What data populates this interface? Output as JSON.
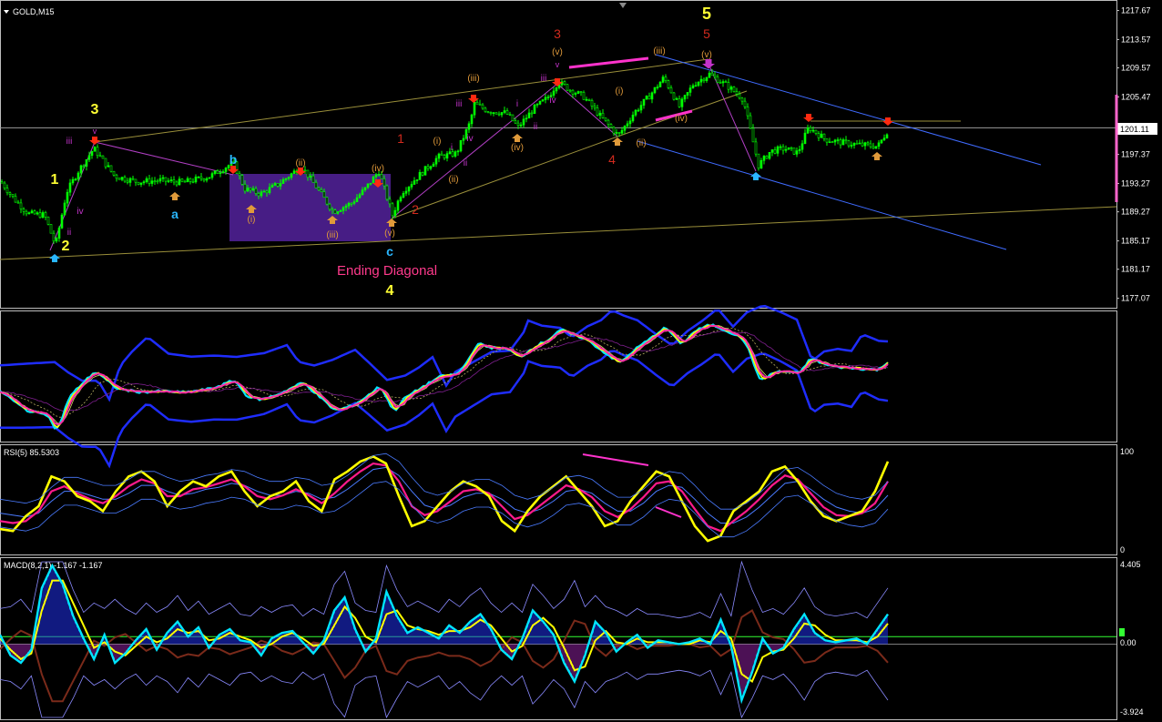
{
  "colors": {
    "background": "#000000",
    "frame": "#bdbdbd",
    "candle": "#00ff00",
    "channel": "#3f6bff",
    "trendline": "#9a8f3a",
    "diagonal_box": "#4b1f8c",
    "ending_text": "#ff3a8c",
    "wave_yellow": "#ffff33",
    "wave_red": "#d22a1e",
    "wave_cyan": "#29b6ff",
    "wave_orange": "#e09a3a",
    "wave_purple": "#c233c9",
    "down_arrow": "#ff2a10",
    "up_arrow": "#29b6ff",
    "band": "#1f2dff",
    "rsi_fast": "#ffff00",
    "rsi_slow": "#ff1a8c",
    "rsi_band": "#4a7bff",
    "macd_main": "#ffff00",
    "macd_signal": "#00e5ff",
    "macd_hist_pos": "#2233ff",
    "macd_hist_neg": "#9922aa",
    "zero_line": "#33ff33",
    "price_line": "#ff66cc"
  },
  "main": {
    "symbol_label": "GOLD,M15",
    "current_price": "1201.11",
    "ending_diagonal_label": "Ending Diagonal"
  },
  "rsi": {
    "title": "RSI(5) 85.5303",
    "top_label": "100",
    "bottom_label": "0"
  },
  "macd": {
    "title": "MACD(8,2,1) -1.167 -1.167",
    "top_label": "4.405",
    "zero_label": "0.00",
    "bottom_label": "-3.924"
  },
  "chart_data": [
    {
      "type": "candlestick",
      "title": "GOLD,M15",
      "ylim": [
        1176.0,
        1218.5
      ],
      "y_ticks": [
        "1217.67",
        "1213.57",
        "1209.57",
        "1205.47",
        "1201.11",
        "1197.37",
        "1193.27",
        "1189.27",
        "1185.17",
        "1181.17",
        "1177.07"
      ],
      "path": [
        [
          0,
          1193.5
        ],
        [
          15,
          1191.0
        ],
        [
          30,
          1189.0
        ],
        [
          48,
          1188.8
        ],
        [
          60,
          1184.5
        ],
        [
          72,
          1192.0
        ],
        [
          85,
          1195.0
        ],
        [
          102,
          1198.2
        ],
        [
          125,
          1194.3
        ],
        [
          150,
          1193.5
        ],
        [
          175,
          1193.7
        ],
        [
          200,
          1193.4
        ],
        [
          230,
          1194.3
        ],
        [
          255,
          1196.2
        ],
        [
          268,
          1192.5
        ],
        [
          285,
          1191.8
        ],
        [
          305,
          1193.2
        ],
        [
          330,
          1195.7
        ],
        [
          345,
          1193.0
        ],
        [
          365,
          1189.3
        ],
        [
          385,
          1190.5
        ],
        [
          400,
          1192.5
        ],
        [
          415,
          1195.0
        ],
        [
          430,
          1188.8
        ],
        [
          440,
          1192.0
        ],
        [
          460,
          1194.5
        ],
        [
          480,
          1197.0
        ],
        [
          500,
          1197.5
        ],
        [
          515,
          1201.8
        ],
        [
          520,
          1204.5
        ],
        [
          535,
          1203.5
        ],
        [
          555,
          1203.2
        ],
        [
          568,
          1201.2
        ],
        [
          585,
          1203.8
        ],
        [
          600,
          1205.3
        ],
        [
          612,
          1207.6
        ],
        [
          625,
          1206.5
        ],
        [
          640,
          1205.5
        ],
        [
          660,
          1202.5
        ],
        [
          678,
          1200.0
        ],
        [
          695,
          1203.2
        ],
        [
          712,
          1205.6
        ],
        [
          728,
          1208.2
        ],
        [
          745,
          1204.1
        ],
        [
          760,
          1207.2
        ],
        [
          778,
          1208.7
        ],
        [
          798,
          1207.0
        ],
        [
          815,
          1205.2
        ],
        [
          832,
          1195.8
        ],
        [
          845,
          1197.8
        ],
        [
          860,
          1198.2
        ],
        [
          875,
          1197.6
        ],
        [
          887,
          1201.2
        ],
        [
          905,
          1199.5
        ],
        [
          925,
          1199.0
        ],
        [
          945,
          1198.7
        ],
        [
          963,
          1198.5
        ],
        [
          975,
          1201.0
        ]
      ],
      "horizontal_line": 1201.11,
      "wave_labels": [
        {
          "text": "3",
          "x": 104,
          "y": 125,
          "color": "yellow",
          "size": 16
        },
        {
          "text": "1",
          "x": 60,
          "y": 202,
          "color": "yellow",
          "size": 16
        },
        {
          "text": "2",
          "x": 72,
          "y": 275,
          "color": "yellow",
          "size": 16
        },
        {
          "text": "iii",
          "x": 76,
          "y": 158,
          "color": "purple",
          "size": 10
        },
        {
          "text": "iv",
          "x": 88,
          "y": 235,
          "color": "purple",
          "size": 10
        },
        {
          "text": "ii",
          "x": 76,
          "y": 258,
          "color": "purple",
          "size": 10
        },
        {
          "text": "v",
          "x": 104,
          "y": 147,
          "color": "purple",
          "size": 9
        },
        {
          "text": "a",
          "x": 192,
          "y": 240,
          "color": "cyan",
          "size": 14
        },
        {
          "text": "b",
          "x": 256,
          "y": 180,
          "color": "cyan",
          "size": 14
        },
        {
          "text": "c",
          "x": 428,
          "y": 281,
          "color": "cyan",
          "size": 14
        },
        {
          "text": "4",
          "x": 428,
          "y": 324,
          "color": "yellow",
          "size": 16
        },
        {
          "text": "(i)",
          "x": 276,
          "y": 244,
          "color": "orange",
          "size": 10
        },
        {
          "text": "(ii)",
          "x": 330,
          "y": 182,
          "color": "orange",
          "size": 10
        },
        {
          "text": "(iii)",
          "x": 365,
          "y": 261,
          "color": "orange",
          "size": 10
        },
        {
          "text": "(iv)",
          "x": 415,
          "y": 188,
          "color": "orange",
          "size": 10
        },
        {
          "text": "(v)",
          "x": 428,
          "y": 259,
          "color": "orange",
          "size": 10
        },
        {
          "text": "1",
          "x": 440,
          "y": 157,
          "color": "red",
          "size": 14
        },
        {
          "text": "2",
          "x": 456,
          "y": 235,
          "color": "red",
          "size": 14
        },
        {
          "text": "(i)",
          "x": 480,
          "y": 158,
          "color": "orange",
          "size": 10
        },
        {
          "text": "(ii)",
          "x": 498,
          "y": 200,
          "color": "orange",
          "size": 10
        },
        {
          "text": "(iii)",
          "x": 520,
          "y": 89,
          "color": "orange",
          "size": 10
        },
        {
          "text": "(iv)",
          "x": 568,
          "y": 165,
          "color": "orange",
          "size": 10
        },
        {
          "text": "(v)",
          "x": 612,
          "y": 60,
          "color": "orange",
          "size": 10
        },
        {
          "text": "3",
          "x": 612,
          "y": 42,
          "color": "red",
          "size": 14
        },
        {
          "text": "iii",
          "x": 504,
          "y": 117,
          "color": "purple",
          "size": 10
        },
        {
          "text": "iv",
          "x": 516,
          "y": 155,
          "color": "purple",
          "size": 10
        },
        {
          "text": "ii",
          "x": 511,
          "y": 182,
          "color": "purple",
          "size": 10
        },
        {
          "text": "i",
          "x": 496,
          "y": 165,
          "color": "purple",
          "size": 10
        },
        {
          "text": "i",
          "x": 568,
          "y": 117,
          "color": "purple",
          "size": 10
        },
        {
          "text": "ii",
          "x": 588,
          "y": 142,
          "color": "purple",
          "size": 10
        },
        {
          "text": "iii",
          "x": 597,
          "y": 89,
          "color": "purple",
          "size": 10
        },
        {
          "text": "iv",
          "x": 607,
          "y": 113,
          "color": "purple",
          "size": 10
        },
        {
          "text": "v",
          "x": 612,
          "y": 74,
          "color": "purple",
          "size": 9
        },
        {
          "text": "4",
          "x": 672,
          "y": 180,
          "color": "red",
          "size": 14
        },
        {
          "text": "(i)",
          "x": 680,
          "y": 103,
          "color": "orange",
          "size": 10
        },
        {
          "text": "(ii)",
          "x": 704,
          "y": 160,
          "color": "orange",
          "size": 10
        },
        {
          "text": "(iii)",
          "x": 724,
          "y": 59,
          "color": "orange",
          "size": 10
        },
        {
          "text": "(iv)",
          "x": 748,
          "y": 133,
          "color": "orange",
          "size": 10
        },
        {
          "text": "(v)",
          "x": 776,
          "y": 63,
          "color": "orange",
          "size": 10
        },
        {
          "text": "5",
          "x": 776,
          "y": 21,
          "color": "yellow",
          "size": 18
        },
        {
          "text": "5",
          "x": 776,
          "y": 42,
          "color": "red",
          "size": 14
        }
      ]
    },
    {
      "type": "line",
      "title": "RSI(5) 85.5303",
      "ylim": [
        0,
        100
      ],
      "y_ticks": [
        "100",
        "0"
      ],
      "series": [
        {
          "values": [
            22,
            20,
            35,
            45,
            75,
            70,
            55,
            50,
            40,
            60,
            75,
            80,
            70,
            45,
            60,
            70,
            65,
            75,
            80,
            60,
            45,
            55,
            60,
            70,
            50,
            40,
            72,
            80,
            90,
            95,
            88,
            55,
            25,
            30,
            45,
            60,
            70,
            65,
            55,
            30,
            20,
            40,
            55,
            65,
            75,
            60,
            45,
            25,
            30,
            50,
            65,
            80,
            75,
            50,
            25,
            10,
            15,
            40,
            50,
            60,
            80,
            85,
            70,
            50,
            35,
            30,
            35,
            40,
            60,
            90
          ]
        },
        {
          "values": [
            30,
            28,
            30,
            40,
            60,
            65,
            58,
            52,
            48,
            55,
            65,
            72,
            68,
            55,
            55,
            62,
            64,
            68,
            72,
            65,
            55,
            52,
            56,
            62,
            56,
            48,
            58,
            70,
            80,
            88,
            86,
            70,
            45,
            36,
            40,
            50,
            60,
            62,
            58,
            45,
            32,
            36,
            46,
            56,
            66,
            62,
            54,
            40,
            34,
            42,
            54,
            68,
            70,
            60,
            42,
            25,
            20,
            30,
            40,
            52,
            66,
            76,
            72,
            58,
            44,
            36,
            35,
            38,
            48,
            70
          ]
        },
        {
          "values": [
            38,
            36,
            34,
            38,
            50,
            60,
            60,
            56,
            52,
            52,
            58,
            66,
            66,
            60,
            56,
            58,
            62,
            64,
            68,
            66,
            60,
            56,
            56,
            60,
            58,
            52,
            54,
            62,
            72,
            82,
            84,
            76,
            60,
            46,
            42,
            46,
            54,
            58,
            58,
            52,
            42,
            38,
            42,
            50,
            60,
            62,
            58,
            48,
            40,
            40,
            48,
            60,
            66,
            64,
            52,
            38,
            28,
            28,
            34,
            44,
            56,
            68,
            70,
            62,
            52,
            44,
            40,
            38,
            42,
            56
          ]
        }
      ]
    },
    {
      "type": "line",
      "title": "MACD(8,2,1) -1.167 -1.167",
      "ylim": [
        -3.924,
        4.405
      ],
      "y_ticks": [
        "4.405",
        "0.00",
        "-3.924"
      ],
      "series": [
        {
          "values": [
            0.5,
            -0.6,
            -1.0,
            -0.3,
            3.0,
            4.2,
            3.2,
            1.5,
            0.3,
            -0.8,
            0.5,
            -1.0,
            -0.5,
            0.2,
            0.8,
            -0.3,
            0.6,
            1.2,
            0.4,
            0.9,
            -0.2,
            0.5,
            0.8,
            0.2,
            0.1,
            -0.6,
            0.3,
            0.6,
            0.7,
            0.1,
            -0.5,
            0.2,
            1.8,
            2.5,
            0.8,
            -0.4,
            0.3,
            2.8,
            1.5,
            0.6,
            0.9,
            0.6,
            0.3,
            1.0,
            0.6,
            1.2,
            1.6,
            0.8,
            -0.3,
            -0.8,
            0.3,
            1.8,
            1.2,
            0.5,
            -1.0,
            -2.0,
            -0.6,
            1.2,
            0.6,
            -0.4,
            0.1,
            0.5,
            -0.2,
            0.2,
            0.1,
            0.0,
            0.1,
            0.3,
            0.0,
            1.3,
            -0.1,
            -3.0,
            -1.5,
            0.3,
            -0.5,
            -0.2,
            0.8,
            1.6,
            0.6,
            0.2,
            0.1,
            0.2,
            0.3,
            0.0,
            0.8,
            1.6
          ]
        },
        {
          "values": [
            0.3,
            -0.3,
            -0.8,
            -0.5,
            1.8,
            3.4,
            3.4,
            2.2,
            1.0,
            -0.2,
            0.1,
            -0.4,
            -0.6,
            -0.1,
            0.4,
            0.1,
            0.3,
            0.8,
            0.6,
            0.7,
            0.2,
            0.3,
            0.6,
            0.4,
            0.2,
            -0.2,
            0.0,
            0.4,
            0.6,
            0.3,
            -0.1,
            0.0,
            1.0,
            2.0,
            1.4,
            0.4,
            0.1,
            1.6,
            1.8,
            1.0,
            0.8,
            0.7,
            0.5,
            0.7,
            0.7,
            0.9,
            1.3,
            1.0,
            0.3,
            -0.4,
            -0.1,
            1.0,
            1.4,
            0.9,
            -0.2,
            -1.4,
            -1.2,
            0.2,
            0.7,
            0.1,
            0.0,
            0.3,
            0.1,
            0.1,
            0.1,
            0.0,
            0.0,
            0.2,
            0.1,
            0.7,
            0.3,
            -1.6,
            -2.0,
            -0.7,
            -0.4,
            -0.3,
            0.3,
            1.1,
            1.0,
            0.5,
            0.2,
            0.2,
            0.2,
            0.1,
            0.4,
            1.1
          ]
        }
      ]
    }
  ]
}
